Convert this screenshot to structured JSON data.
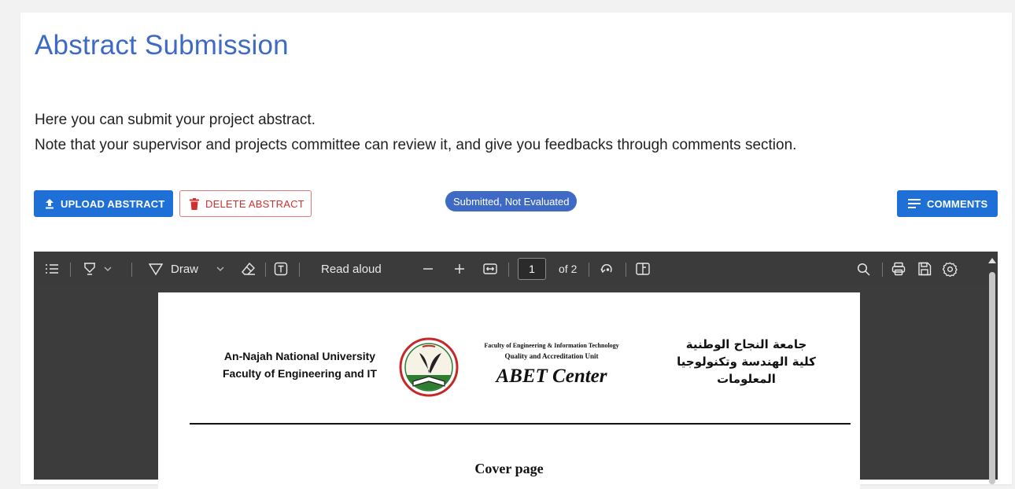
{
  "header": {
    "title": "Abstract Submission"
  },
  "intro": {
    "line1": "Here you can submit your project abstract.",
    "line2": "Note that your supervisor and projects committee can review it, and give you feedbacks through comments section."
  },
  "actions": {
    "upload_label": "UPLOAD ABSTRACT",
    "delete_label": "DELETE ABSTRACT",
    "comments_label": "COMMENTS",
    "status": "Submitted, Not Evaluated"
  },
  "pdf_toolbar": {
    "draw_label": "Draw",
    "read_aloud_label": "Read aloud",
    "current_page": "1",
    "total_pages_label": "of 2",
    "icons": [
      "contents-icon",
      "highlight-icon",
      "chevron-down-icon",
      "draw-icon",
      "eraser-icon",
      "text-box-icon",
      "zoom-out-icon",
      "zoom-in-icon",
      "fit-page-icon",
      "rotate-icon",
      "page-view-icon",
      "search-icon",
      "print-icon",
      "save-icon",
      "settings-icon"
    ]
  },
  "pdf_page": {
    "university_en_line1": "An-Najah National University",
    "university_en_line2": "Faculty of Engineering and IT",
    "faculty_line": "Faculty of Engineering & Information Technology",
    "quality_line": "Quality and Accreditation Unit",
    "center_name": "ABET Center",
    "university_ar_line1": "جامعة النجاح الوطنية",
    "university_ar_line2": "كلية الهندسة وتكنولوجيا المعلومات",
    "cover_title": "Cover page"
  },
  "colors": {
    "primary": "#1e6fd6",
    "title": "#3e6ac6",
    "danger": "#d32f2f",
    "viewer_bg": "#3c3c3c"
  }
}
